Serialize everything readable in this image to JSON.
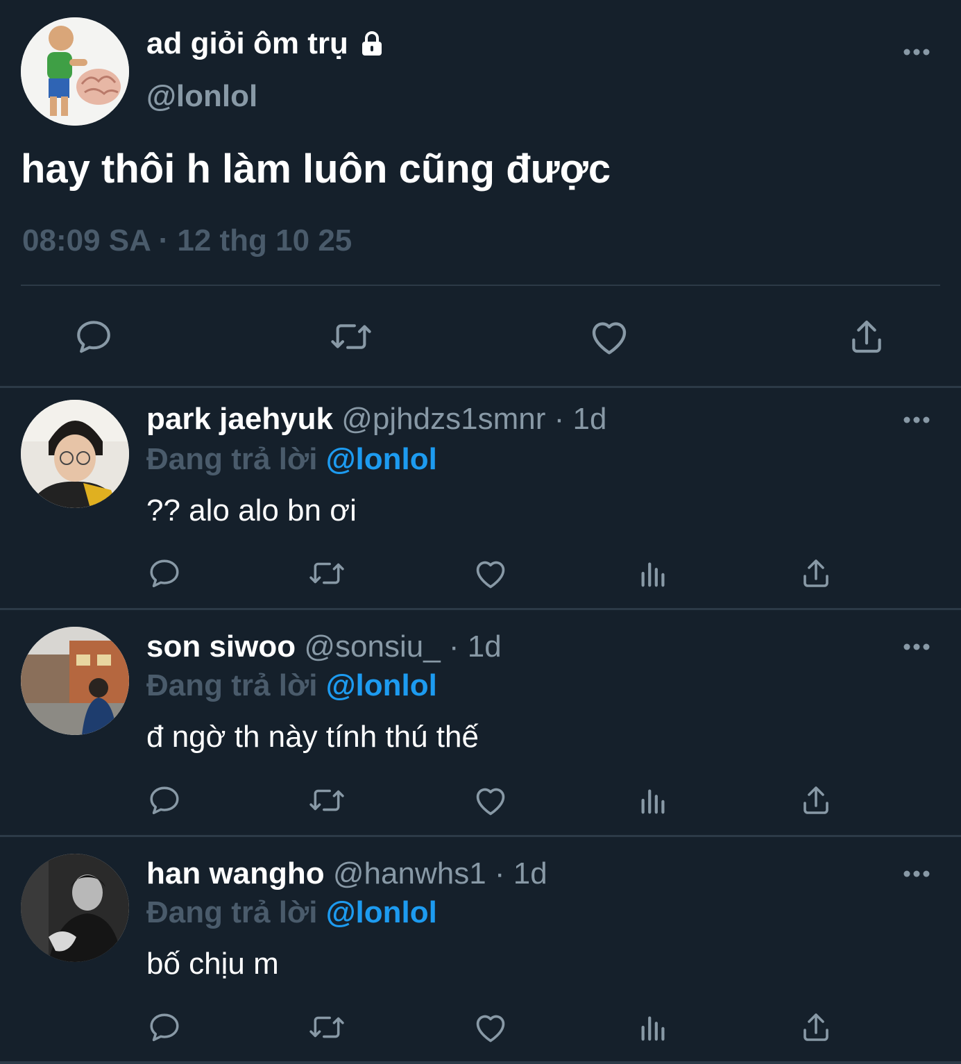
{
  "main": {
    "display_name": "ad giỏi ôm trụ",
    "handle": "@lonlol",
    "text": "hay thôi h làm luôn cũng được",
    "timestamp": "08:09 SA · 12 thg 10 25"
  },
  "replies": [
    {
      "display_name": "park jaehyuk",
      "handle": "@pjhdzs1smnr · 1d",
      "replying_prefix": "Đang trả lời ",
      "replying_to": "@lonlol",
      "text": "?? alo alo bn ơi"
    },
    {
      "display_name": "son siwoo",
      "handle": "@sonsiu_ · 1d",
      "replying_prefix": "Đang trả lời ",
      "replying_to": "@lonlol",
      "text": "đ ngờ th này tính thú thế"
    },
    {
      "display_name": "han wangho",
      "handle": "@hanwhs1 · 1d",
      "replying_prefix": "Đang trả lời ",
      "replying_to": "@lonlol",
      "text": "bố chịu m"
    }
  ],
  "icons": {
    "lock": "lock-icon",
    "more": "more-icon",
    "reply": "reply-icon",
    "retweet": "retweet-icon",
    "like": "like-icon",
    "views": "views-icon",
    "share": "share-icon"
  },
  "colors": {
    "background": "#15202b",
    "mention": "#1d9bf0",
    "secondary": "#8899a6",
    "icon": "#8899a6"
  }
}
